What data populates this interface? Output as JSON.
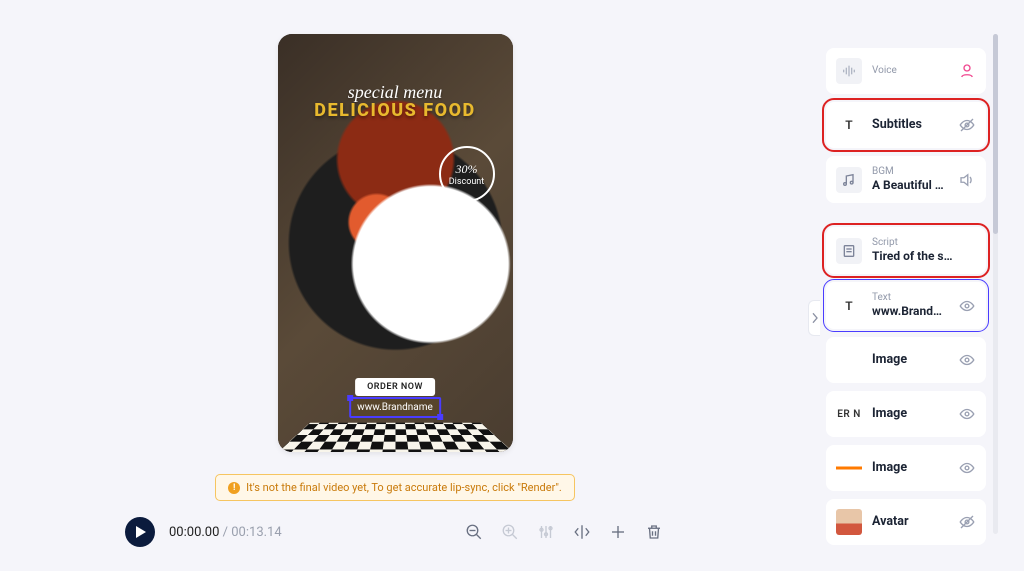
{
  "canvas": {
    "scriptLine": "special menu",
    "headline": "DELICIOUS FOOD",
    "discountPct": "30%",
    "discountWord": "Discount",
    "cta": "ORDER NOW",
    "brandText": "www.Brandname"
  },
  "warning": "It's not the final video yet, To get accurate lip-sync, click \"Render\".",
  "player": {
    "current": "00:00.00",
    "duration": "00:13.14"
  },
  "layers": {
    "voice": {
      "label": "Voice"
    },
    "subtitles": {
      "title": "Subtitles"
    },
    "bgm": {
      "label": "BGM",
      "value": "A Beautiful Sky"
    },
    "script": {
      "label": "Script",
      "value": "Tired of the s…"
    },
    "text": {
      "label": "Text",
      "value": "www.Brandna…"
    },
    "image1": {
      "title": "Image"
    },
    "image2": {
      "title": "Image",
      "thumbText": "ER N"
    },
    "image3": {
      "title": "Image"
    },
    "avatar": {
      "title": "Avatar"
    }
  }
}
